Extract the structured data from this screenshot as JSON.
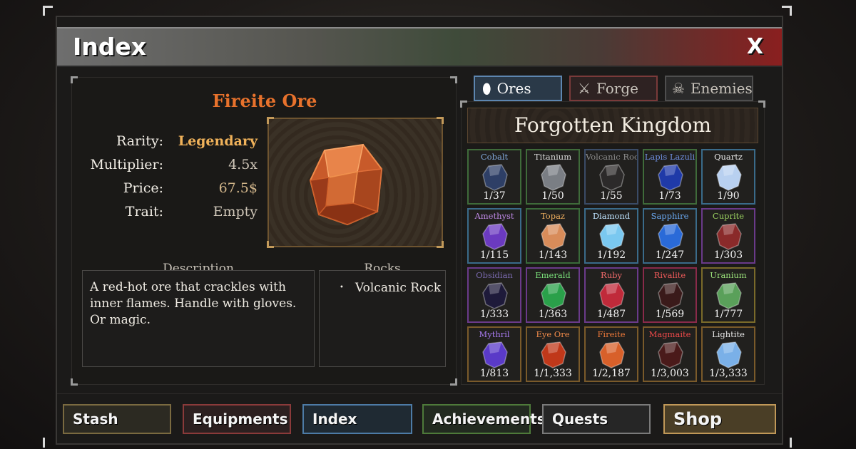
{
  "window": {
    "title": "Index",
    "close_label": "X"
  },
  "detail": {
    "name": "Fireite Ore",
    "stats": [
      {
        "label": "Rarity:",
        "value": "Legendary"
      },
      {
        "label": "Multiplier:",
        "value": "4.5x"
      },
      {
        "label": "Price:",
        "value": "67.5$"
      },
      {
        "label": "Trait:",
        "value": "Empty"
      }
    ],
    "description_title": "Description",
    "description": "A red-hot ore that crackles with inner flames. Handle with gloves. Or magic.",
    "rocks_title": "Rocks",
    "rocks": [
      "Volcanic Rock"
    ]
  },
  "tabs": [
    {
      "label": "Ores",
      "icon": "ore-icon"
    },
    {
      "label": "Forge",
      "icon": "sword-icon"
    },
    {
      "label": "Enemies",
      "icon": "skull-icon"
    }
  ],
  "region": "Forgotten Kingdom",
  "ores": [
    {
      "name": "Cobalt",
      "count": "1/37",
      "name_color": "#7fa6d8",
      "border": "#3f6b3a",
      "gem": "#2e3f66"
    },
    {
      "name": "Titanium",
      "count": "1/50",
      "name_color": "#d8d8d8",
      "border": "#3f6b3a",
      "gem": "#7a7e84"
    },
    {
      "name": "Volcanic Rock",
      "count": "1/55",
      "name_color": "#8a8a8a",
      "border": "#3a4b66",
      "gem": "#2c2a2a"
    },
    {
      "name": "Lapis Lazuli",
      "count": "1/73",
      "name_color": "#6f8fe0",
      "border": "#3f6b3a",
      "gem": "#1f3aa8"
    },
    {
      "name": "Quartz",
      "count": "1/90",
      "name_color": "#e8e8e8",
      "border": "#3a6b8a",
      "gem": "#b8d0f0"
    },
    {
      "name": "Amethyst",
      "count": "1/115",
      "name_color": "#c08ae8",
      "border": "#3a6b8a",
      "gem": "#6b3ac0"
    },
    {
      "name": "Topaz",
      "count": "1/143",
      "name_color": "#f0b060",
      "border": "#3a6b3a",
      "gem": "#d88c5a"
    },
    {
      "name": "Diamond",
      "count": "1/192",
      "name_color": "#bfe4ff",
      "border": "#3a6b8a",
      "gem": "#7ac8f0"
    },
    {
      "name": "Sapphire",
      "count": "1/247",
      "name_color": "#6aa8f0",
      "border": "#3a6b8a",
      "gem": "#2a6ad8"
    },
    {
      "name": "Cuprite",
      "count": "1/303",
      "name_color": "#9ad060",
      "border": "#6a3a8a",
      "gem": "#8a2a2a"
    },
    {
      "name": "Obsidian",
      "count": "1/333",
      "name_color": "#7a6ab0",
      "border": "#6a3a8a",
      "gem": "#1e1a3a"
    },
    {
      "name": "Emerald",
      "count": "1/363",
      "name_color": "#7ae07a",
      "border": "#6a3a8a",
      "gem": "#2aa04a"
    },
    {
      "name": "Ruby",
      "count": "1/487",
      "name_color": "#f06a6a",
      "border": "#6a3a8a",
      "gem": "#c02a3a"
    },
    {
      "name": "Rivalite",
      "count": "1/569",
      "name_color": "#f05a5a",
      "border": "#8a2a4a",
      "gem": "#3a1a1a"
    },
    {
      "name": "Uranium",
      "count": "1/777",
      "name_color": "#9ae07a",
      "border": "#7a6a2a",
      "gem": "#5aa05a"
    },
    {
      "name": "Mythril",
      "count": "1/813",
      "name_color": "#a87af0",
      "border": "#7a5a2a",
      "gem": "#5a3ac8"
    },
    {
      "name": "Eye Ore",
      "count": "1/1,333",
      "name_color": "#f08a4a",
      "border": "#7a5a2a",
      "gem": "#c0381a"
    },
    {
      "name": "Fireite",
      "count": "1/2,187",
      "name_color": "#f07a3a",
      "border": "#7a5a2a",
      "gem": "#d8602a"
    },
    {
      "name": "Magmaite",
      "count": "1/3,003",
      "name_color": "#f04a4a",
      "border": "#7a5a2a",
      "gem": "#4a1a1a"
    },
    {
      "name": "Lightite",
      "count": "1/3,333",
      "name_color": "#e8e8e8",
      "border": "#7a5a2a",
      "gem": "#7ab0e8"
    }
  ],
  "nav": [
    {
      "label": "Stash"
    },
    {
      "label": "Equipments"
    },
    {
      "label": "Index"
    },
    {
      "label": "Achievements"
    },
    {
      "label": "Quests"
    },
    {
      "label": "Shop"
    }
  ],
  "colors": {
    "accent_orange": "#e8722c",
    "legendary": "#f0b25a",
    "ores_tab": "#5d86b0"
  }
}
